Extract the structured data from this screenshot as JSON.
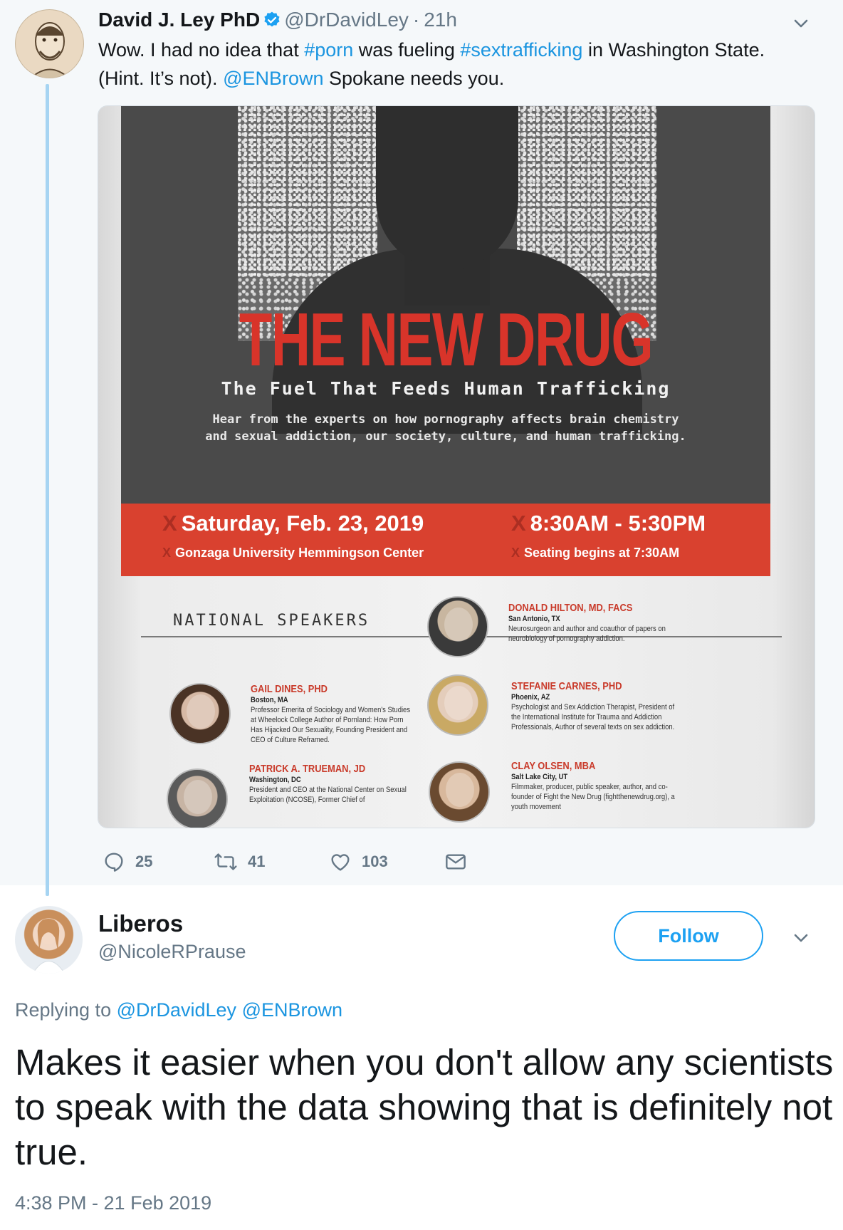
{
  "parent_tweet": {
    "name": "David J. Ley PhD",
    "handle": "@DrDavidLey",
    "separator": "·",
    "time": "21h",
    "text_part1": "Wow. I had no idea that ",
    "hashtag1": "#porn",
    "text_part2": " was fueling ",
    "hashtag2": "#sextrafficking",
    "text_part3": " in Washington State. (Hint. It’s not). ",
    "mention": "@ENBrown",
    "text_part4": " Spokane needs you.",
    "reply_count": "25",
    "retweet_count": "41",
    "like_count": "103"
  },
  "flyer": {
    "title": "THE NEW DRUG",
    "subtitle": "The Fuel That Feeds Human Trafficking",
    "desc_line1": "Hear from the experts on how pornography affects brain chemistry",
    "desc_line2": "and sexual addiction, our society, culture, and human trafficking.",
    "date": "Saturday, Feb. 23, 2019",
    "venue": "Gonzaga University Hemmingson Center",
    "hours": "8:30AM - 5:30PM",
    "seating": "Seating begins at 7:30AM",
    "x_mark": "X",
    "section_title": "NATIONAL SPEAKERS",
    "speakers": [
      {
        "name": "DONALD HILTON, MD, FACS",
        "location": "San Antonio, TX",
        "desc": "Neurosurgeon and author and coauthor of papers on neurobiology of pornography addiction."
      },
      {
        "name": "GAIL DINES, PHD",
        "location": "Boston, MA",
        "desc": "Professor Emerita of Sociology and Women's Studies at Wheelock College Author of Pornland: How Porn Has Hijacked Our Sexuality, Founding President and CEO of Culture Reframed."
      },
      {
        "name": "STEFANIE CARNES, PHD",
        "location": "Phoenix, AZ",
        "desc": "Psychologist and Sex Addiction Therapist, President of the International Institute for Trauma and Addiction Professionals, Author of several texts on sex addiction."
      },
      {
        "name": "PATRICK A. TRUEMAN, JD",
        "location": "Washington, DC",
        "desc": "President and CEO at the National Center on Sexual Exploitation (NCOSE), Former Chief of"
      },
      {
        "name": "CLAY OLSEN, MBA",
        "location": "Salt Lake City, UT",
        "desc": "Filmmaker, producer, public speaker, author, and co-founder of Fight the New Drug (fightthenewdrug.org), a youth movement"
      }
    ]
  },
  "reply_tweet": {
    "name": "Liberos",
    "handle": "@NicoleRPrause",
    "follow_label": "Follow",
    "replying_prefix": "Replying to ",
    "replying_to1": "@DrDavidLey",
    "replying_to2": "@ENBrown",
    "text": "Makes it easier when you don't allow any scientists to speak with the data showing that is definitely not true.",
    "timestamp": "4:38 PM - 21 Feb 2019"
  },
  "colors": {
    "link": "#1b95e0",
    "accent": "#1da1f2",
    "muted": "#657786",
    "thread_line": "#a6d4f2",
    "flyer_red": "#d9412f"
  },
  "icons": [
    "verified-badge-icon",
    "chevron-down-icon",
    "reply-icon",
    "retweet-icon",
    "like-icon",
    "direct-message-icon"
  ]
}
